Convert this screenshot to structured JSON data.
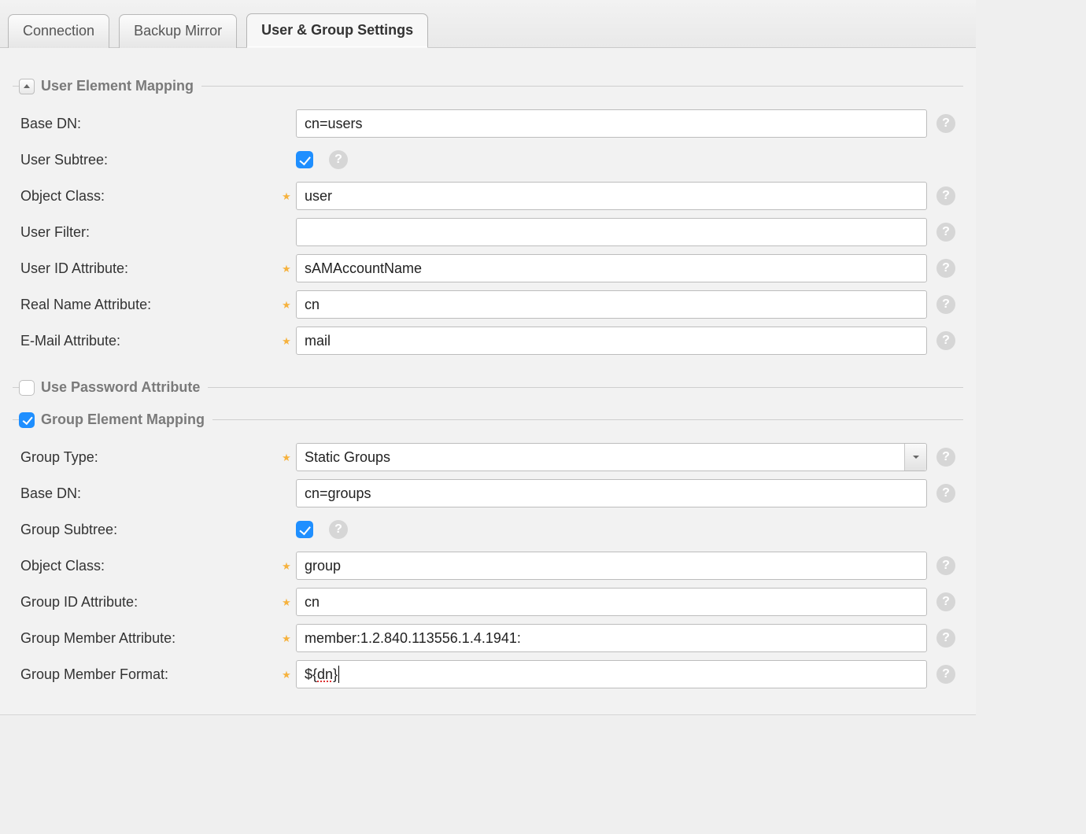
{
  "tabs": {
    "connection": "Connection",
    "backup_mirror": "Backup Mirror",
    "user_group": "User & Group Settings"
  },
  "user_mapping": {
    "legend": "User Element Mapping",
    "base_dn": {
      "label": "Base DN:",
      "value": "cn=users"
    },
    "user_subtree": {
      "label": "User Subtree:",
      "checked": true
    },
    "object_class": {
      "label": "Object Class:",
      "value": "user"
    },
    "user_filter": {
      "label": "User Filter:",
      "value": ""
    },
    "user_id_attr": {
      "label": "User ID Attribute:",
      "value": "sAMAccountName"
    },
    "real_name_attr": {
      "label": "Real Name Attribute:",
      "value": "cn"
    },
    "email_attr": {
      "label": "E-Mail Attribute:",
      "value": "mail"
    }
  },
  "password_attr": {
    "legend": "Use Password Attribute",
    "checked": false
  },
  "group_mapping": {
    "legend": "Group Element Mapping",
    "checked": true,
    "group_type": {
      "label": "Group Type:",
      "value": "Static Groups"
    },
    "base_dn": {
      "label": "Base DN:",
      "value": "cn=groups"
    },
    "group_subtree": {
      "label": "Group Subtree:",
      "checked": true
    },
    "object_class": {
      "label": "Object Class:",
      "value": "group"
    },
    "group_id_attr": {
      "label": "Group ID Attribute:",
      "value": "cn"
    },
    "group_member_attr": {
      "label": "Group Member Attribute:",
      "value": "member:1.2.840.113556.1.4.1941:"
    },
    "group_member_format": {
      "label": "Group Member Format:",
      "value_prefix": "${",
      "value_err": "dn",
      "value_suffix": "}"
    }
  }
}
